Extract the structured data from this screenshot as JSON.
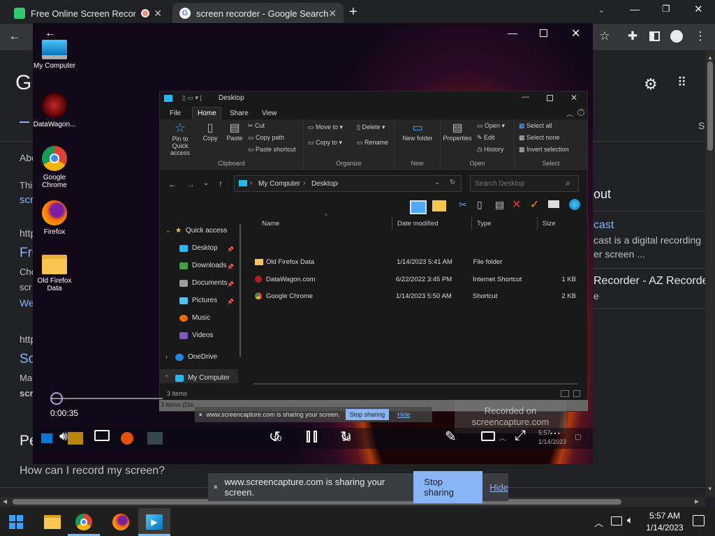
{
  "browser": {
    "tabs": [
      {
        "label": "Free Online Screen Recorder",
        "active": false
      },
      {
        "label": "screen recorder - Google Search",
        "active": true
      }
    ],
    "new_tab_label": "+"
  },
  "page": {
    "logo_letter": "G",
    "sidebar_snippets": [
      "Abo",
      "This",
      "scr",
      "http",
      "Fre",
      "Che",
      "scr",
      "We",
      "http",
      "So",
      "Ma",
      "scr",
      "Pe"
    ],
    "right_snippets": [
      "out",
      "cast",
      "cast is a digital recording",
      "er screen ...",
      "Recorder - AZ Recorde",
      "e"
    ],
    "right_tab": "S",
    "question": "How can I record my screen?"
  },
  "player": {
    "time": "0:00:35",
    "progress": 0.02,
    "rewind_label": "10",
    "forward_label": "30",
    "watermark_line1": "Recorded on",
    "watermark_line2": "screencapture.com"
  },
  "desktop_icons": [
    {
      "label": "My Computer",
      "icon": "monitor-icon"
    },
    {
      "label": "DataWagon...",
      "icon": "datawagon-icon"
    },
    {
      "label": "Google Chrome",
      "icon": "chrome-icon"
    },
    {
      "label": "Firefox",
      "icon": "firefox-icon"
    },
    {
      "label": "Old Firefox Data",
      "icon": "folder-icon"
    }
  ],
  "explorer": {
    "title": "Desktop",
    "menu": [
      "File",
      "Home",
      "Share",
      "View"
    ],
    "ribbon": {
      "pin": "Pin to Quick access",
      "copy": "Copy",
      "paste": "Paste",
      "cut": "Cut",
      "copy_path": "Copy path",
      "paste_shortcut": "Paste shortcut",
      "clipboard": "Clipboard",
      "move_to": "Move to",
      "copy_to": "Copy to",
      "delete": "Delete",
      "rename": "Rename",
      "organize": "Organize",
      "new_folder": "New folder",
      "new": "New",
      "properties": "Properties",
      "open_btn": "Open",
      "edit": "Edit",
      "history": "History",
      "open_group": "Open",
      "select_all": "Select all",
      "select_none": "Select none",
      "invert_selection": "Invert selection",
      "select": "Select"
    },
    "address": [
      "My Computer",
      "Desktop"
    ],
    "search_placeholder": "Search Desktop",
    "nav": {
      "quick_access": "Quick access",
      "items": [
        "Desktop",
        "Downloads",
        "Documents",
        "Pictures",
        "Music",
        "Videos"
      ],
      "onedrive": "OneDrive",
      "my_computer": "My Computer"
    },
    "columns": [
      "Name",
      "Date modified",
      "Type",
      "Size"
    ],
    "files": [
      {
        "name": "Old Firefox Data",
        "date": "1/14/2023 5:41 AM",
        "type": "File folder",
        "size": ""
      },
      {
        "name": "DataWagon.com",
        "date": "6/22/2022 3:45 PM",
        "type": "Internet Shortcut",
        "size": "1 KB"
      },
      {
        "name": "Google Chrome",
        "date": "1/14/2023 5:50 AM",
        "type": "Shortcut",
        "size": "2 KB"
      }
    ],
    "status": "3 items",
    "status2": "3 items (Dis"
  },
  "inner_share": {
    "text": "www.screencapture.com is sharing your screen.",
    "stop": "Stop sharing",
    "hide": "Hide"
  },
  "inner_tray": {
    "date": "1/14/2023",
    "time": "5:57"
  },
  "share": {
    "text": "www.screencapture.com is sharing your screen.",
    "stop": "Stop sharing",
    "hide": "Hide"
  },
  "taskbar": {
    "time": "5:57 AM",
    "date": "1/14/2023"
  }
}
